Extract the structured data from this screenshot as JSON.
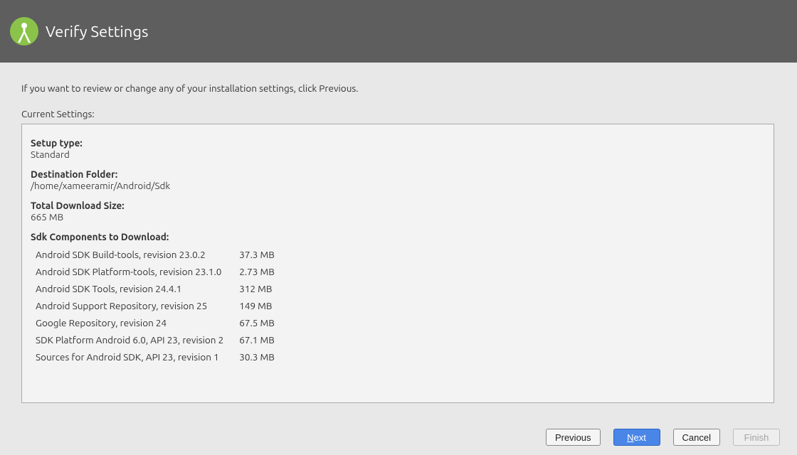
{
  "header": {
    "title": "Verify Settings"
  },
  "instruction": "If you want to review or change any of your installation settings, click Previous.",
  "settings_label": "Current Settings:",
  "panel": {
    "setup_type_label": "Setup type:",
    "setup_type_value": "Standard",
    "destination_label": "Destination Folder:",
    "destination_value": "/home/xameeramir/Android/Sdk",
    "download_size_label": "Total Download Size:",
    "download_size_value": "665 MB",
    "components_label": "Sdk Components to Download:",
    "components": [
      {
        "name": "Android SDK Build-tools, revision 23.0.2",
        "size": "37.3 MB"
      },
      {
        "name": "Android SDK Platform-tools, revision 23.1.0",
        "size": "2.73 MB"
      },
      {
        "name": "Android SDK Tools, revision 24.4.1",
        "size": "312 MB"
      },
      {
        "name": "Android Support Repository, revision 25",
        "size": "149 MB"
      },
      {
        "name": "Google Repository, revision 24",
        "size": "67.5 MB"
      },
      {
        "name": "SDK Platform Android 6.0, API 23, revision 2",
        "size": "67.1 MB"
      },
      {
        "name": "Sources for Android SDK, API 23, revision 1",
        "size": "30.3 MB"
      }
    ]
  },
  "footer": {
    "previous": "Previous",
    "next_prefix": "N",
    "next_suffix": "ext",
    "cancel": "Cancel",
    "finish": "Finish"
  }
}
